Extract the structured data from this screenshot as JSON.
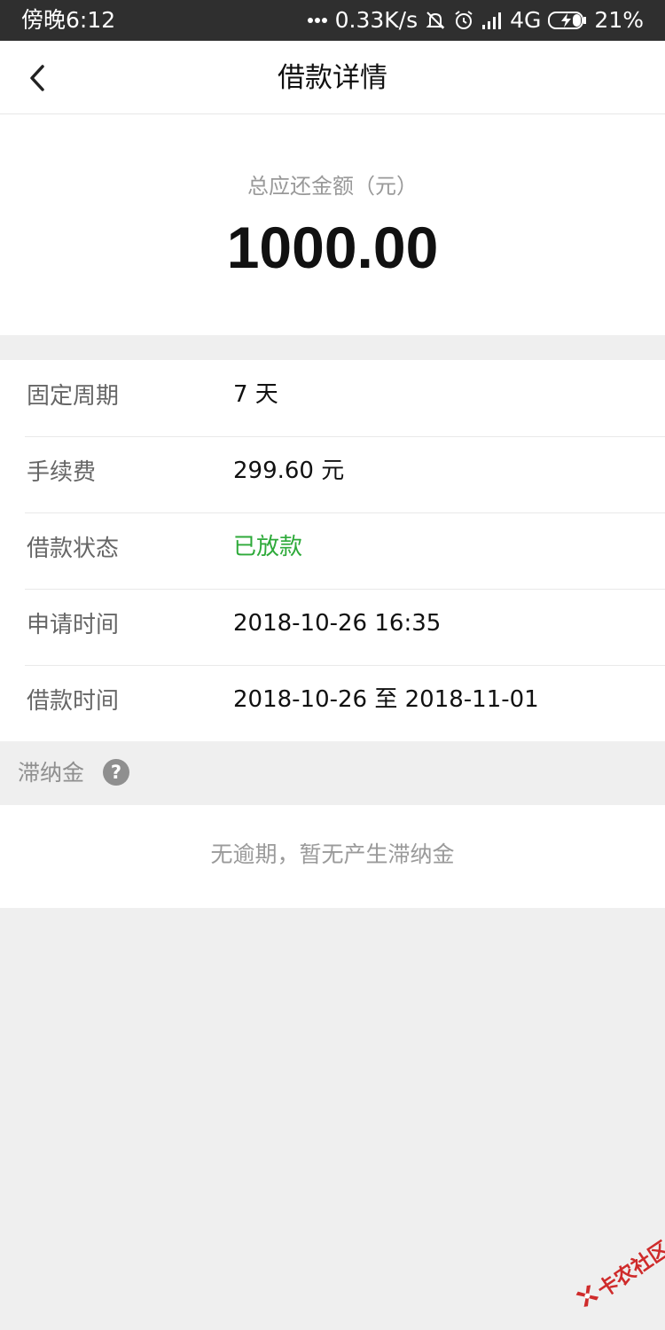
{
  "status_bar": {
    "time": "傍晚6:12",
    "speed": "0.33K/s",
    "network": "4G",
    "battery": "21%"
  },
  "nav": {
    "title": "借款详情"
  },
  "summary": {
    "label": "总应还金额（元）",
    "amount": "1000.00"
  },
  "details": [
    {
      "label": "固定周期",
      "value": "7 天"
    },
    {
      "label": "手续费",
      "value": "299.60 元"
    },
    {
      "label": "借款状态",
      "value": "已放款",
      "value_color": "#2eaa3a"
    },
    {
      "label": "申请时间",
      "value": "2018-10-26 16:35"
    },
    {
      "label": "借款时间",
      "value": "2018-10-26 至 2018-11-01"
    }
  ],
  "late_fee": {
    "title": "滞纳金",
    "help_symbol": "?",
    "message": "无逾期，暂无产生滞纳金"
  },
  "watermark": {
    "text": "卡农社区"
  }
}
